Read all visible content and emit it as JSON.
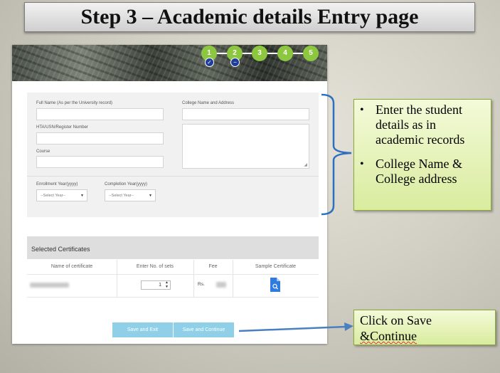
{
  "slide": {
    "title": "Step 3 – Academic details Entry page"
  },
  "steps": [
    {
      "label": "1",
      "state": "done"
    },
    {
      "label": "2",
      "state": "current"
    },
    {
      "label": "3",
      "state": "todo"
    },
    {
      "label": "4",
      "state": "todo"
    },
    {
      "label": "5",
      "state": "todo"
    }
  ],
  "form": {
    "full_name_label": "Full Name (As per the University record)",
    "register_label": "HTA/USN/Register Number",
    "course_label": "Course",
    "college_label": "College Name and Address",
    "enrollment_label": "Enrollment Year(yyyy)",
    "completion_label": "Completion Year(yyyy)",
    "enrollment_select": "--Select Year--",
    "completion_select": "--Select Year--"
  },
  "certificates": {
    "heading": "Selected Certificates",
    "columns": [
      "Name of certificate",
      "Enter No. of sets",
      "Fee",
      "Sample Certificate"
    ],
    "row": {
      "sets": "1",
      "fee_prefix": "Rs."
    }
  },
  "buttons": {
    "save_exit": "Save and Exit",
    "save_continue": "Save and Continue"
  },
  "callouts": {
    "bullets": [
      "Enter the student details as in academic records",
      "College Name & College address"
    ],
    "note_line1": "Click on Save",
    "note_line2": "&Continue"
  },
  "colors": {
    "step_green": "#8dc63f",
    "step_marker": "#1f3d99",
    "button_blue": "#8fd0e8",
    "callout_green": "#d9ec9e",
    "bracket_blue": "#2e6fbf"
  }
}
